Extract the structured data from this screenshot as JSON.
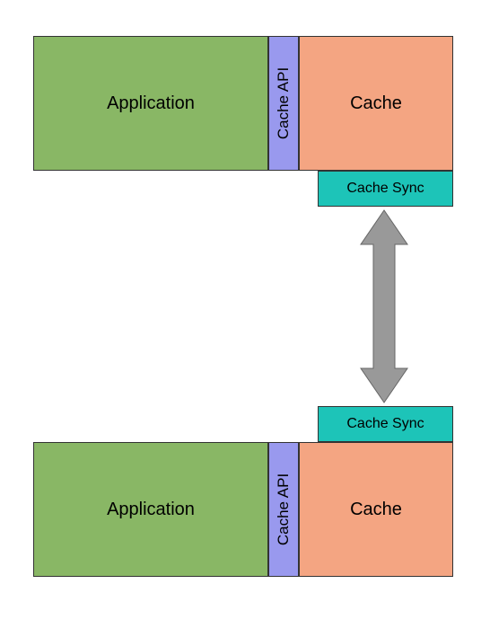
{
  "top": {
    "application": "Application",
    "api": "Cache API",
    "cache": "Cache",
    "sync": "Cache Sync"
  },
  "bottom": {
    "application": "Application",
    "api": "Cache API",
    "cache": "Cache",
    "sync": "Cache Sync"
  },
  "colors": {
    "application": "#89b765",
    "api": "#9999ee",
    "cache": "#f4a582",
    "sync": "#1dc4b8",
    "arrow": "#999999"
  }
}
